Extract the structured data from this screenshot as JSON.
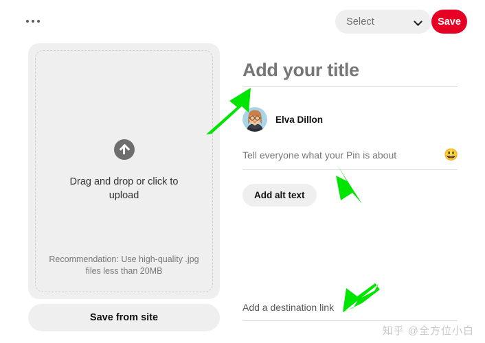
{
  "topbar": {
    "more_menu_icon": "ellipsis-icon",
    "board_select_value": "Select",
    "chevron_icon": "chevron-down-icon",
    "save_label": "Save"
  },
  "upload": {
    "arrow_icon": "upload-arrow-icon",
    "prompt": "Drag and drop or click to upload",
    "recommendation": "Recommendation: Use high-quality .jpg files less than 20MB",
    "save_from_site_label": "Save from site"
  },
  "form": {
    "title_placeholder": "Add your title",
    "profile_name": "Elva Dillon",
    "avatar_icon": "user-avatar-illustration",
    "description_placeholder": "Tell everyone what your Pin is about",
    "emoji_icon": "grinning-face-emoji",
    "emoji_glyph": "😃",
    "alt_text_label": "Add alt text",
    "destination_link_placeholder": "Add a destination link"
  },
  "annotations": {
    "arrow_color": "#00E500",
    "arrow_title_icon": "green-arrow-up-right-icon",
    "arrow_description_icon": "green-arrow-up-left-icon",
    "arrow_link_icon": "green-arrow-down-left-icon"
  },
  "watermark": {
    "text": "知乎 @全方位小白"
  },
  "colors": {
    "brand_red": "#e60023",
    "field_gray": "#efefef",
    "placeholder_gray": "#767676"
  }
}
